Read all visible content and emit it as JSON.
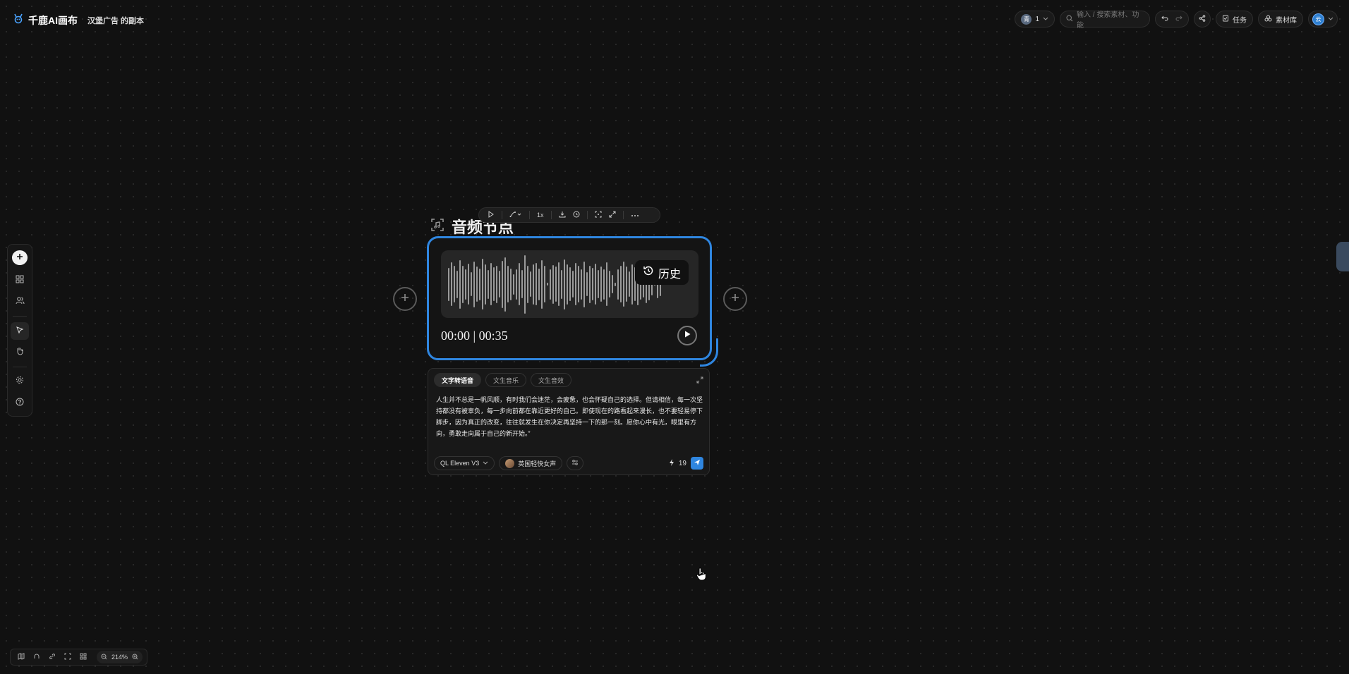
{
  "header": {
    "app_name": "千鹿AI画布",
    "project_name": "汉堡广告 的副本",
    "member_initial": "青",
    "member_count": "1",
    "search_placeholder": "输入 / 搜索素材、功能",
    "task_label": "任务",
    "library_label": "素材库",
    "user_avatar_text": "云"
  },
  "node": {
    "title": "音频节点",
    "toolbar_speed": "1x",
    "history_label": "历史",
    "time_current": "00:00",
    "time_total": "00:35",
    "waveform_levels": [
      0.55,
      0.72,
      0.6,
      0.45,
      0.8,
      0.62,
      0.5,
      0.68,
      0.4,
      0.75,
      0.58,
      0.52,
      0.84,
      0.66,
      0.48,
      0.7,
      0.56,
      0.62,
      0.44,
      0.78,
      0.9,
      0.6,
      0.52,
      0.34,
      0.5,
      0.7,
      0.46,
      0.96,
      0.62,
      0.42,
      0.66,
      0.7,
      0.52,
      0.8,
      0.6,
      0.05,
      0.5,
      0.64,
      0.58,
      0.72,
      0.48,
      0.82,
      0.66,
      0.56,
      0.44,
      0.7,
      0.6,
      0.5,
      0.76,
      0.4,
      0.62,
      0.54,
      0.68,
      0.46,
      0.58,
      0.5,
      0.72,
      0.44,
      0.3,
      0.06,
      0.5,
      0.6,
      0.74,
      0.58,
      0.42,
      0.66,
      0.56,
      0.7,
      0.5,
      0.44,
      0.62,
      0.52,
      0.36,
      0.05,
      0.46,
      0.4
    ]
  },
  "text_panel": {
    "tabs": [
      "文字转语音",
      "文生音乐",
      "文生音效"
    ],
    "active_tab": 0,
    "prompt": "人生并不总是一帆风顺，有时我们会迷茫，会疲惫，也会怀疑自己的选择。但请相信，每一次坚持都没有被辜负，每一步向前都在靠近更好的自己。即使现在的路看起来漫长，也不要轻易停下脚步，因为真正的改变，往往就发生在你决定再坚持一下的那一刻。愿你心中有光，眼里有方向，勇敢走向属于自己的新开始。”",
    "model": "QL Eleven V3",
    "voice": "英国轻快女声",
    "credits": "19"
  },
  "zoom": {
    "level": "214%"
  },
  "colors": {
    "accent": "#2f86e0",
    "background": "#111111"
  }
}
